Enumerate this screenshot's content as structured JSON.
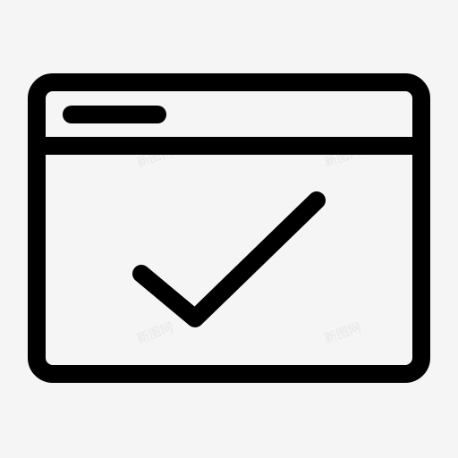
{
  "icon": {
    "name": "browser-window-check-icon",
    "stroke_color": "#000000",
    "background_color": "#f5f5f5"
  },
  "watermark": {
    "text": "新图网"
  }
}
